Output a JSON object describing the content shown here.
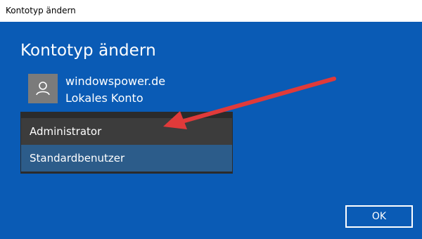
{
  "window": {
    "title": "Kontotyp ändern"
  },
  "dialog": {
    "heading": "Kontotyp ändern",
    "account": {
      "name": "windowspower.de",
      "type": "Lokales Konto",
      "avatar_icon": "user-icon"
    },
    "dropdown": {
      "options": [
        "Administrator",
        "Standardbenutzer"
      ],
      "selected": "Standardbenutzer"
    },
    "ok_label": "OK"
  },
  "colors": {
    "background": "#0a5bb5",
    "dropdown_bg": "#2b2b2b",
    "hover_bg": "#3c3c3c",
    "selected_bg": "#2c5c8a",
    "arrow": "#e03a3a"
  }
}
